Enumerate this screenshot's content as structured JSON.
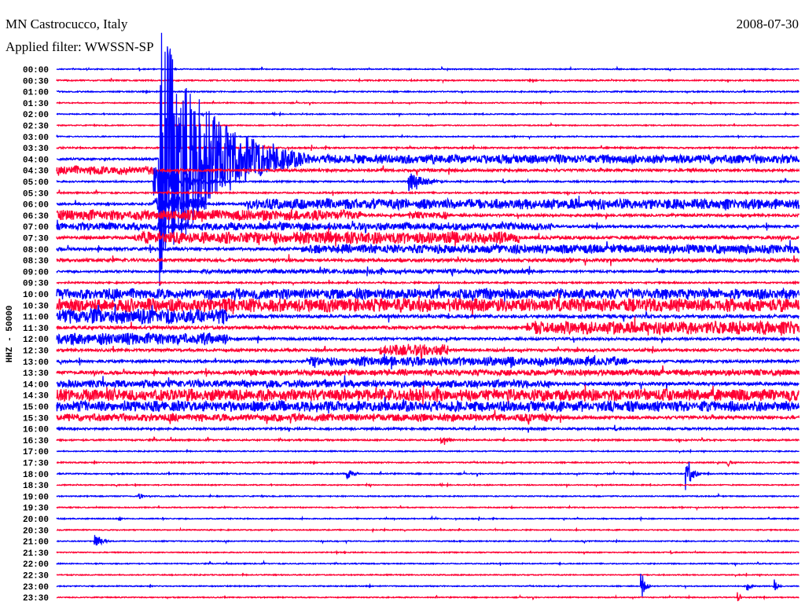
{
  "header": {
    "station": "MN Castrocucco, Italy",
    "date": "2008-07-30",
    "filter": "Applied filter: WWSSN-SP"
  },
  "chart_data": {
    "type": "line",
    "title": "MN Castrocucco, Italy",
    "ylabel": "HHZ - 50000",
    "minutes_per_line": 30,
    "colors": {
      "hour": "#0000ff",
      "half_hour": "#ff0033"
    },
    "rows": [
      "00:00",
      "00:30",
      "01:00",
      "01:30",
      "02:00",
      "02:30",
      "03:00",
      "03:30",
      "04:00",
      "04:30",
      "05:00",
      "05:30",
      "06:00",
      "06:30",
      "07:00",
      "07:30",
      "08:00",
      "08:30",
      "09:00",
      "09:30",
      "10:00",
      "10:30",
      "11:00",
      "11:30",
      "12:00",
      "12:30",
      "13:00",
      "13:30",
      "14:00",
      "14:30",
      "15:00",
      "15:30",
      "16:00",
      "16:30",
      "17:00",
      "17:30",
      "18:00",
      "18:30",
      "19:00",
      "19:30",
      "20:00",
      "20:30",
      "21:00",
      "21:30",
      "22:00",
      "22:30",
      "23:00",
      "23:30"
    ],
    "background_amplitude": [
      1,
      1.2,
      1.2,
      1,
      1,
      1,
      1,
      1.5,
      2,
      2.5,
      1.5,
      1.5,
      2,
      2.5,
      2.5,
      3,
      3,
      3,
      2,
      1.5,
      3,
      4,
      3,
      3,
      2.5,
      2.5,
      2.5,
      3,
      3,
      3,
      3,
      3,
      2,
      1.5,
      1,
      1.2,
      1.2,
      1,
      1,
      1,
      1,
      1,
      1,
      1,
      1,
      1,
      1,
      1
    ],
    "events": [
      {
        "row": 8,
        "start_min": 4.1,
        "end_min": 10.0,
        "amplitude": 180,
        "decay": true
      },
      {
        "row": 8,
        "start_min": 7.9,
        "end_min": 30,
        "amplitude": 6
      },
      {
        "row": 9,
        "start_min": 0,
        "end_min": 3.9,
        "amplitude": 6
      },
      {
        "row": 10,
        "start_min": 3.9,
        "end_min": 7.2,
        "amplitude": 20,
        "decay": true
      },
      {
        "row": 10,
        "start_min": 14.2,
        "end_min": 16.1,
        "amplitude": 13,
        "decay": true
      },
      {
        "row": 12,
        "start_min": 3.9,
        "end_min": 6.0,
        "amplitude": 10
      },
      {
        "row": 12,
        "start_min": 7.6,
        "end_min": 30,
        "amplitude": 7
      },
      {
        "row": 13,
        "start_min": 0,
        "end_min": 12.3,
        "amplitude": 7
      },
      {
        "row": 13,
        "start_min": 14.2,
        "end_min": 15.8,
        "amplitude": 5
      },
      {
        "row": 14,
        "start_min": 0,
        "end_min": 20.0,
        "amplitude": 5
      },
      {
        "row": 15,
        "start_min": 3.1,
        "end_min": 18.7,
        "amplitude": 8
      },
      {
        "row": 16,
        "start_min": 9.9,
        "end_min": 30,
        "amplitude": 6
      },
      {
        "row": 18,
        "start_min": 5.8,
        "end_min": 19.3,
        "amplitude": 3
      },
      {
        "row": 20,
        "start_min": 0,
        "end_min": 30,
        "amplitude": 7
      },
      {
        "row": 21,
        "start_min": 0,
        "end_min": 30,
        "amplitude": 9
      },
      {
        "row": 22,
        "start_min": 0,
        "end_min": 6.9,
        "amplitude": 10
      },
      {
        "row": 23,
        "start_min": 19.0,
        "end_min": 30,
        "amplitude": 9
      },
      {
        "row": 24,
        "start_min": 0,
        "end_min": 6.9,
        "amplitude": 8
      },
      {
        "row": 25,
        "start_min": 13.0,
        "end_min": 15.8,
        "amplitude": 8
      },
      {
        "row": 26,
        "start_min": 10.1,
        "end_min": 23.1,
        "amplitude": 6
      },
      {
        "row": 27,
        "start_min": 7.2,
        "end_min": 30,
        "amplitude": 4
      },
      {
        "row": 28,
        "start_min": 0,
        "end_min": 20.0,
        "amplitude": 5
      },
      {
        "row": 29,
        "start_min": 0,
        "end_min": 30,
        "amplitude": 8
      },
      {
        "row": 30,
        "start_min": 0,
        "end_min": 30,
        "amplitude": 7
      },
      {
        "row": 31,
        "start_min": 0,
        "end_min": 20.0,
        "amplitude": 5
      },
      {
        "row": 33,
        "start_min": 15.5,
        "end_min": 16.5,
        "amplitude": 5,
        "decay": true
      },
      {
        "row": 35,
        "start_min": 27.1,
        "end_min": 27.7,
        "amplitude": 6,
        "decay": true
      },
      {
        "row": 36,
        "start_min": 25.4,
        "end_min": 26.0,
        "amplitude": 32,
        "decay": true
      },
      {
        "row": 36,
        "start_min": 11.7,
        "end_min": 12.5,
        "amplitude": 8,
        "decay": true
      },
      {
        "row": 38,
        "start_min": 3.3,
        "end_min": 3.8,
        "amplitude": 5,
        "decay": true
      },
      {
        "row": 40,
        "start_min": 2.5,
        "end_min": 2.9,
        "amplitude": 4,
        "decay": true
      },
      {
        "row": 42,
        "start_min": 1.5,
        "end_min": 2.3,
        "amplitude": 12,
        "decay": true
      },
      {
        "row": 46,
        "start_min": 23.6,
        "end_min": 24.0,
        "amplitude": 25,
        "decay": true
      },
      {
        "row": 46,
        "start_min": 27.9,
        "end_min": 28.3,
        "amplitude": 8,
        "decay": true
      },
      {
        "row": 46,
        "start_min": 29.0,
        "end_min": 29.4,
        "amplitude": 10,
        "decay": true
      },
      {
        "row": 47,
        "start_min": 27.5,
        "end_min": 27.8,
        "amplitude": 10,
        "decay": true
      }
    ]
  }
}
